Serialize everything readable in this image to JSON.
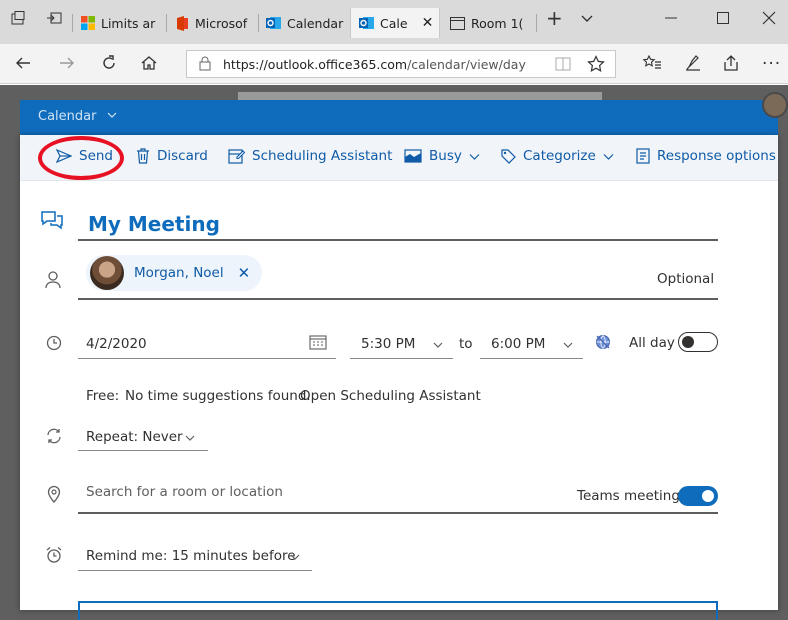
{
  "browser": {
    "tabs": [
      {
        "label": "Limits ar"
      },
      {
        "label": "Microsof"
      },
      {
        "label": "Calendar"
      },
      {
        "label": "Cale"
      },
      {
        "label": "Room 1("
      }
    ],
    "new_tab": "+",
    "url_host": "https://outlook.office365.com",
    "url_path": "/calendar/view/day"
  },
  "app": {
    "title": "Calendar"
  },
  "commands": {
    "send": "Send",
    "discard": "Discard",
    "scheduling": "Scheduling Assistant",
    "busy": "Busy",
    "categorize": "Categorize",
    "response": "Response options"
  },
  "event": {
    "title": "My Meeting",
    "attendee": "Morgan, Noel",
    "optional": "Optional",
    "date": "4/2/2020",
    "start": "5:30 PM",
    "to": "to",
    "end": "6:00 PM",
    "all_day": "All day",
    "free_label": "Free:",
    "suggestion": "No time suggestions found.",
    "open_scheduling": "Open Scheduling Assistant",
    "repeat": "Repeat: Never",
    "location_placeholder": "Search for a room or location",
    "teams": "Teams meeting",
    "remind": "Remind me: 15 minutes before"
  },
  "colors": {
    "accent": "#0f6cbd",
    "highlight": "#e81123"
  }
}
